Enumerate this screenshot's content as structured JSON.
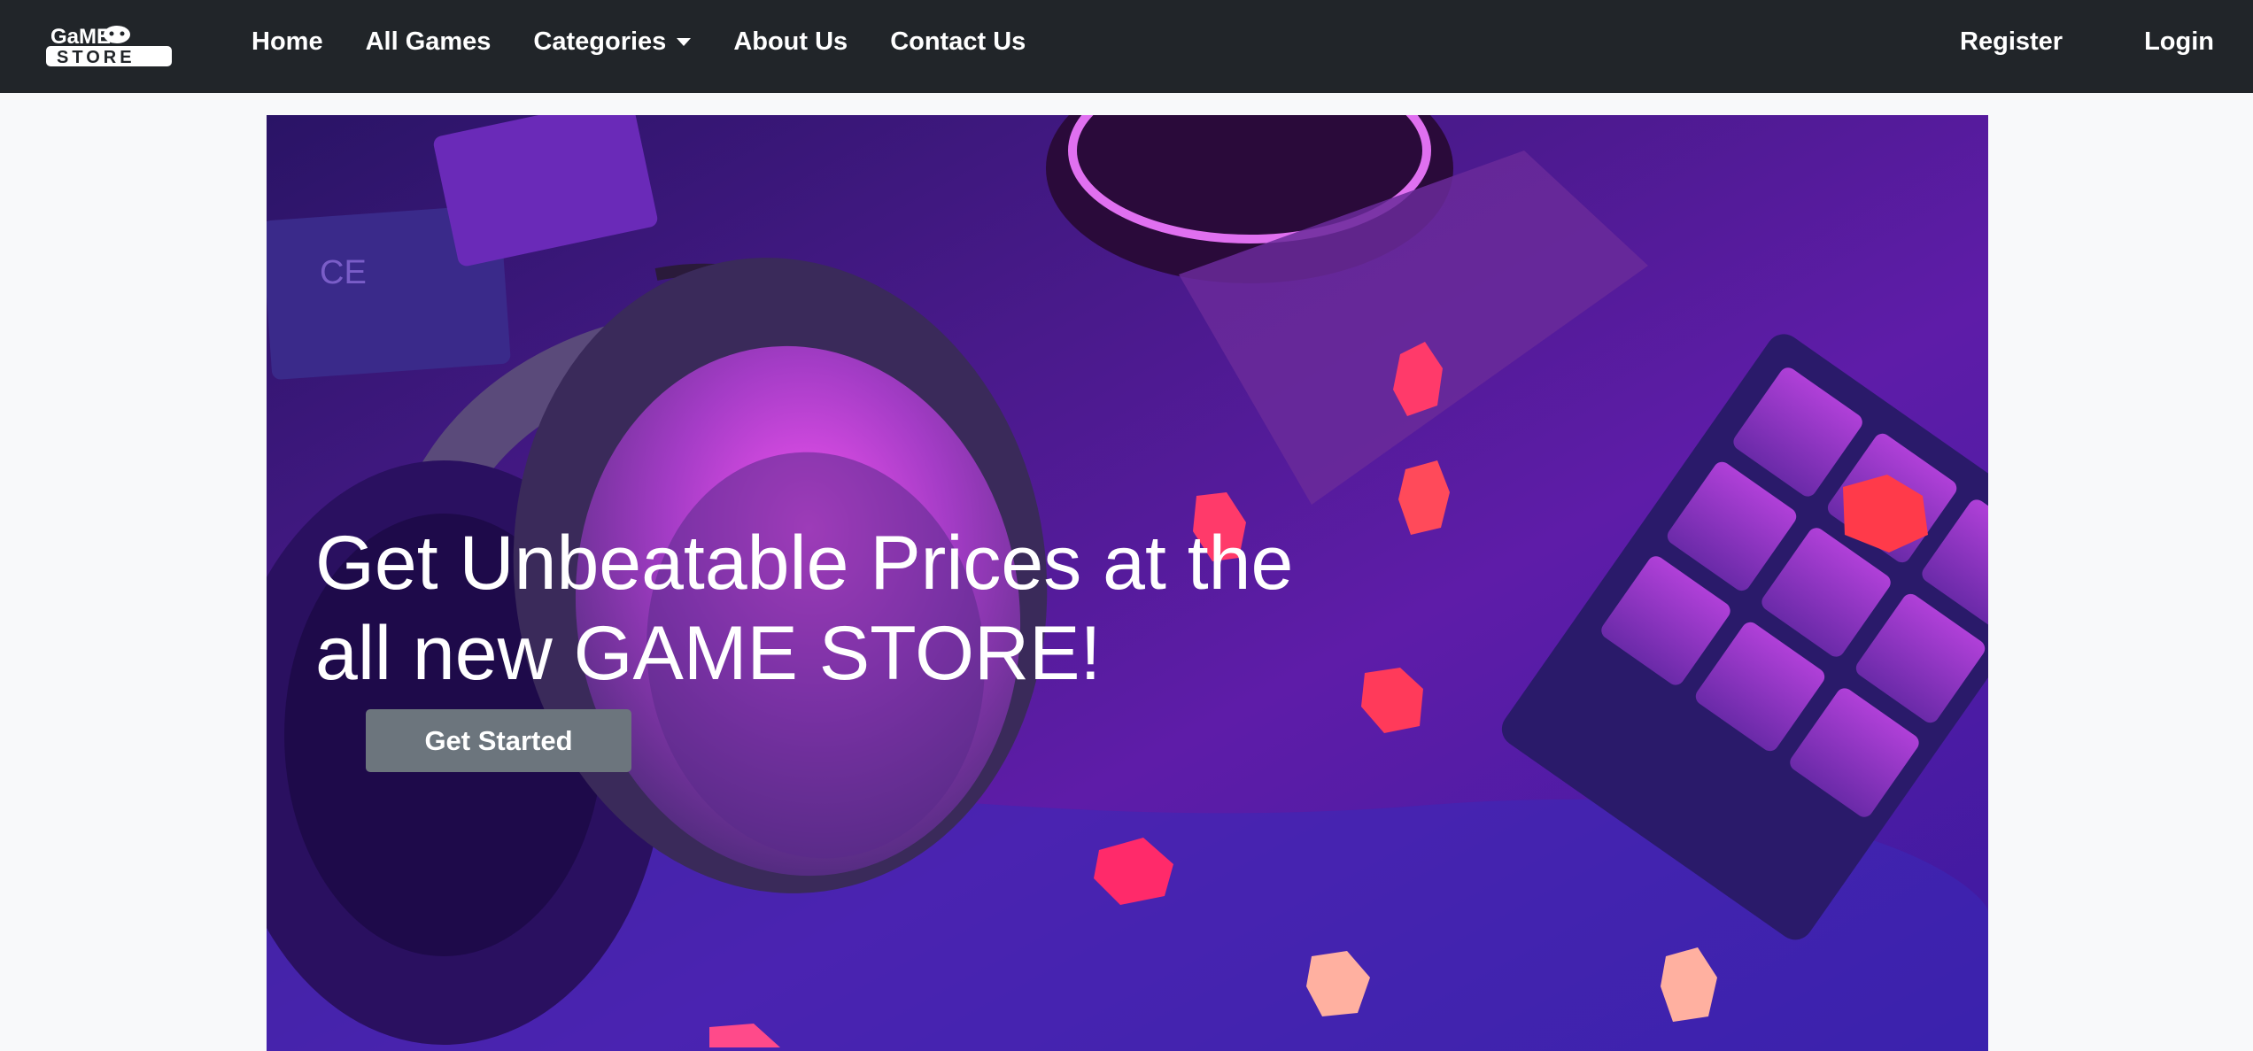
{
  "brand": {
    "logo_line1": "GaME",
    "logo_line2": "STORE"
  },
  "nav": {
    "home": "Home",
    "all_games": "All Games",
    "categories": "Categories",
    "about": "About Us",
    "contact": "Contact Us",
    "register": "Register",
    "login": "Login"
  },
  "hero": {
    "title": "Get Unbeatable Prices at the all new GAME STORE!",
    "cta_label": "Get Started",
    "image": "gaming-headset-keyboard-neon-photo"
  },
  "colors": {
    "navbar": "#212529",
    "page_bg": "#f8f9fa",
    "button": "#6c757d",
    "text_light": "#ffffff"
  },
  "icons": {
    "categories_dropdown": "caret-down-icon",
    "logo_controller": "gamepad-icon"
  }
}
